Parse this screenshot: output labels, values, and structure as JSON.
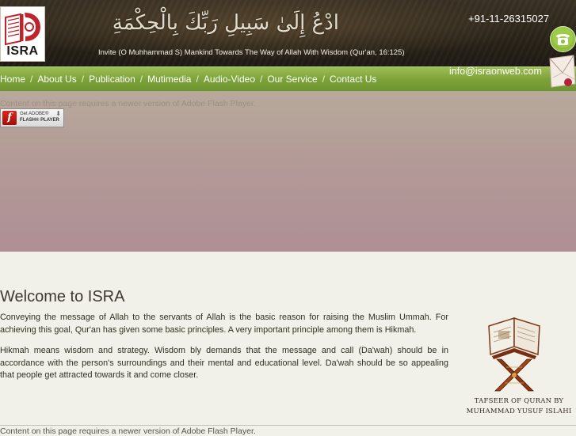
{
  "header": {
    "logo_text": "ISRA",
    "calligraphy": "ادْعُ إِلَىٰ سَبِيلِ رَبِّكَ بِالْحِكْمَةِ",
    "tagline": "Invite (O Muhhammad S) Mankind Towards The Way of Allah With Wisdom (Qur'an, 16:125)",
    "phone": "+91-11-26315027",
    "email": "info@israonweb.com"
  },
  "nav": {
    "items": [
      {
        "label": "Home"
      },
      {
        "label": "About Us"
      },
      {
        "label": "Publication"
      },
      {
        "label": "Mutimedia"
      },
      {
        "label": "Audio-Video"
      },
      {
        "label": "Our Service"
      },
      {
        "label": "Contact Us"
      }
    ],
    "separator": "/"
  },
  "flash": {
    "message": "Content on this page requires a newer version of Adobe Flash Player.",
    "badge_get": "Get ADOBE®",
    "badge_player": "FLASH® PLAYER",
    "badge_logo": "f"
  },
  "main": {
    "title": "Welcome to ISRA",
    "paragraphs": [
      "Conveying the message of Allah to the servants of Allah is the basic reason for raising the Muslim Ummah. For achieving this goal, Qur'an has given some basic principles. A very important principle among them is Hikmah.",
      "Hikmah means wisdom and strategy. Wisdom bly demands that the message and call (Da'wah) should be in accordance with the person's surroundings and their mental and educational level. Da'wah should be so appealing that people get attracted towards it and come closer."
    ],
    "feature_caption_line1": "TAFSEER OF QURAN BY",
    "feature_caption_line2": "MUHAMMAD YUSUF ISLAHI"
  },
  "footer": {
    "flash_message": "Content on this page requires a newer version of Adobe Flash Player."
  },
  "colors": {
    "nav_green": "#7ea33a",
    "header_dark": "#2a241a",
    "banner": "#b39b97",
    "page_bg": "#f1f1e9"
  }
}
